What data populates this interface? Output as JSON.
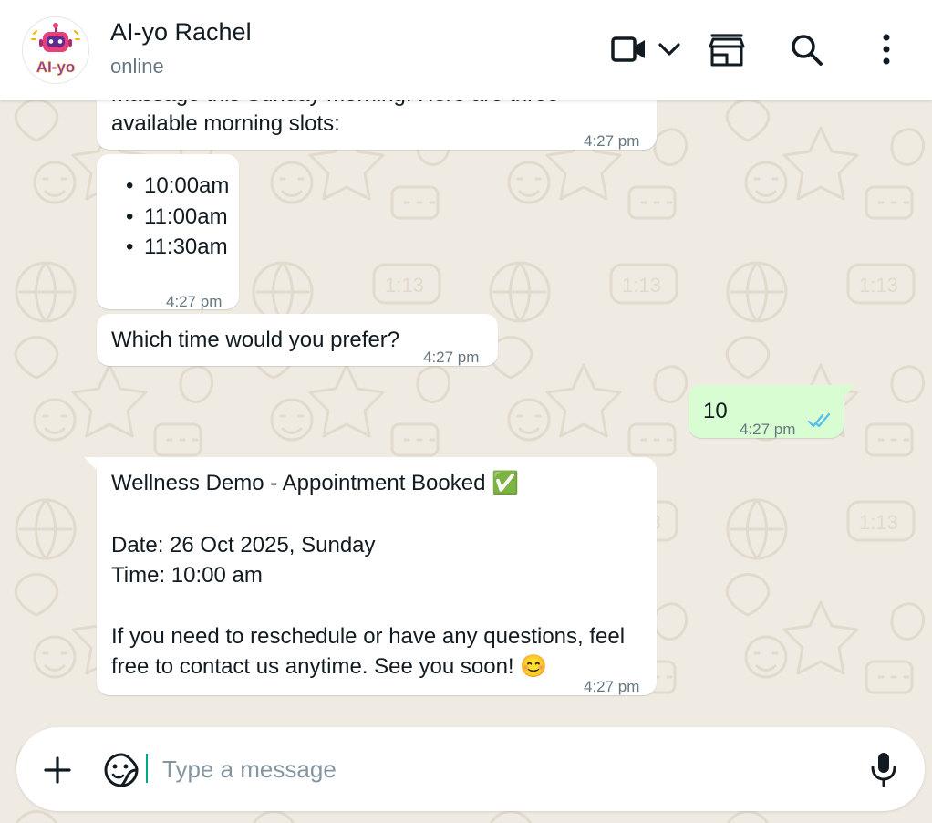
{
  "header": {
    "contact_name": "AI-yo Rachel",
    "status": "online",
    "avatar_logo_text": "AI-yo",
    "icons": [
      "video-call-icon",
      "chevron-down-icon",
      "store-icon",
      "search-icon",
      "more-vertical-icon"
    ]
  },
  "messages": [
    {
      "direction": "incoming",
      "lines": [
        "massage this Sunday morning. Here are three",
        "available morning slots:"
      ],
      "time": "4:27 pm",
      "partially_cut_off": true
    },
    {
      "direction": "incoming",
      "bullets": [
        "10:00am",
        "11:00am",
        "11:30am"
      ],
      "time": "4:27 pm"
    },
    {
      "direction": "incoming",
      "text": "Which time would you prefer?",
      "time": "4:27 pm"
    },
    {
      "direction": "outgoing",
      "text": "10",
      "time": "4:27 pm",
      "status": "read"
    },
    {
      "direction": "incoming",
      "title": "Wellness Demo - Appointment Booked ✅",
      "date_line": "Date: 26 Oct 2025, Sunday",
      "time_line": "Time: 10:00 am",
      "closing_line_1": "If you need to reschedule or have any questions, feel",
      "closing_line_2": "free to contact us anytime. See you soon! 😊",
      "time": "4:27 pm"
    }
  ],
  "composer": {
    "placeholder": "Type a message",
    "value": "",
    "icons": [
      "plus-icon",
      "sticker-icon",
      "microphone-icon"
    ]
  },
  "colors": {
    "chat_background": "#efeae2",
    "incoming_bubble": "#ffffff",
    "outgoing_bubble": "#d9fdd3",
    "read_ticks": "#53bdeb",
    "timestamp": "#667781",
    "header_background": "#ffffff"
  }
}
